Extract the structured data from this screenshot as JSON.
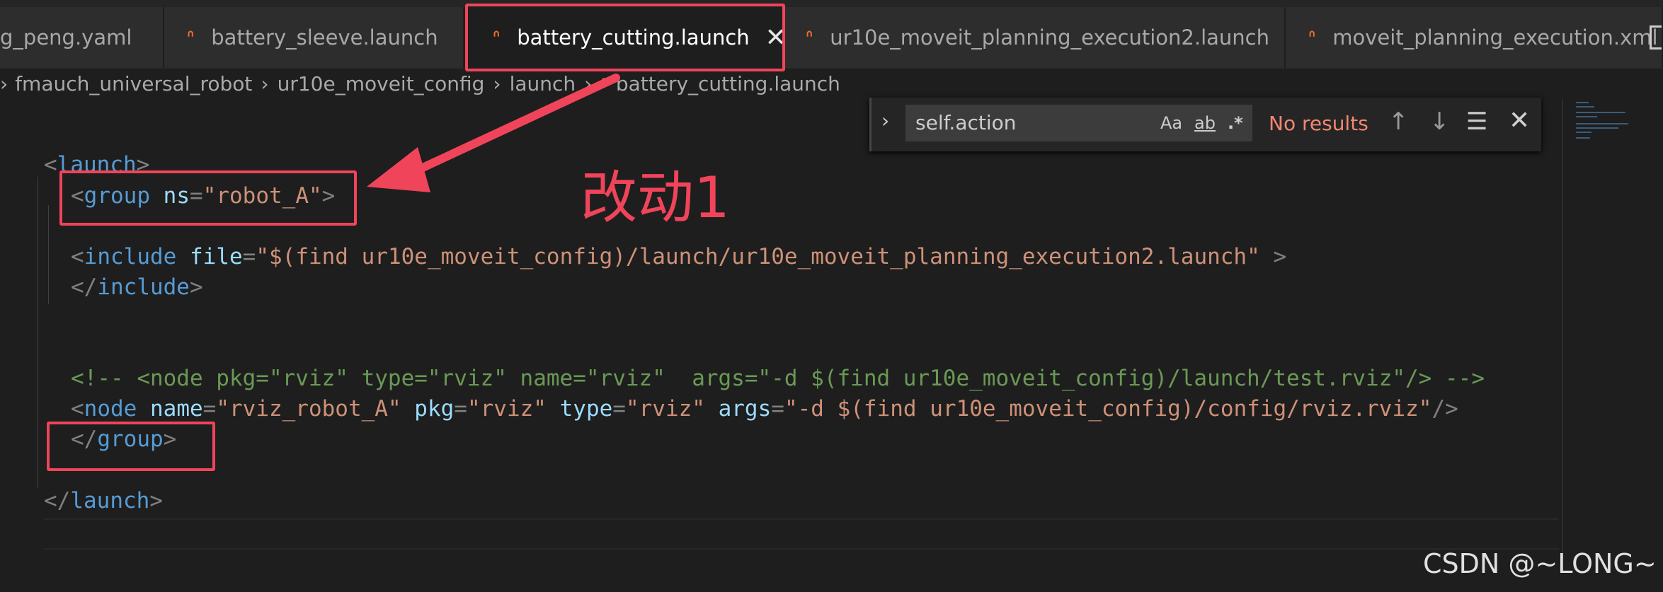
{
  "tabs": [
    {
      "label": "g_peng.yaml",
      "icon": "yaml-file-icon"
    },
    {
      "label": "battery_sleeve.launch",
      "icon": "rss-xml-icon"
    },
    {
      "label": "battery_cutting.launch",
      "icon": "rss-xml-icon",
      "active": true,
      "close": "✕"
    },
    {
      "label": "ur10e_moveit_planning_execution2.launch",
      "icon": "rss-xml-icon"
    },
    {
      "label": "moveit_planning_execution.xml",
      "icon": "rss-xml-icon"
    }
  ],
  "breadcrumb": [
    "fmauch_universal_robot",
    "ur10e_moveit_config",
    "launch",
    "battery_cutting.launch"
  ],
  "find": {
    "query": "self.action",
    "match_case": "Aa",
    "whole_word": "ab",
    "regex": ".*",
    "status": "No results"
  },
  "code": {
    "launch_open": "launch",
    "group_tag": "group",
    "group_attr": "ns",
    "group_value": "\"robot_A\"",
    "include_tag": "include",
    "include_attr": "file",
    "include_value": "\"$(find ur10e_moveit_config)/launch/ur10e_moveit_planning_execution2.launch\"",
    "include_close": "include",
    "comment": "<!-- <node pkg=\"rviz\" type=\"rviz\" name=\"rviz\"  args=\"-d $(find ur10e_moveit_config)/launch/test.rviz\"/> -->",
    "node_tag": "node",
    "node_name_attr": "name",
    "node_name_value": "\"rviz_robot_A\"",
    "node_pkg_attr": "pkg",
    "node_pkg_value": "\"rviz\"",
    "node_type_attr": "type",
    "node_type_value": "\"rviz\"",
    "node_args_attr": "args",
    "node_args_value": "\"-d $(find ur10e_moveit_config)/config/rviz.rviz\"",
    "group_close": "group",
    "launch_close": "launch"
  },
  "annotation": {
    "label": "改动1",
    "color": "#f0445a"
  },
  "watermark": "CSDN @~LONG~"
}
